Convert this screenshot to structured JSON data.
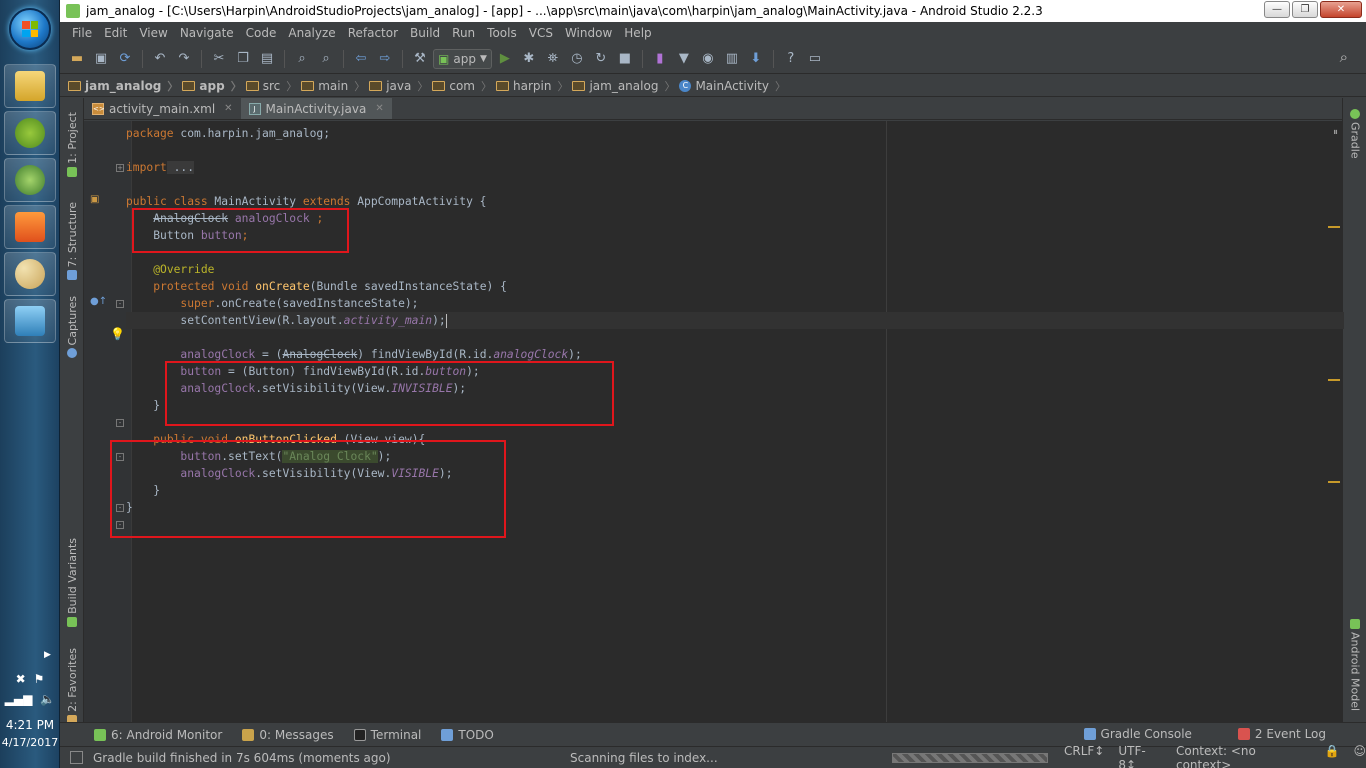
{
  "window": {
    "title": "jam_analog - [C:\\Users\\Harpin\\AndroidStudioProjects\\jam_analog] - [app] - ...\\app\\src\\main\\java\\com\\harpin\\jam_analog\\MainActivity.java - Android Studio 2.2.3",
    "minimize": "—",
    "restore": "❐",
    "close": "✕"
  },
  "menu": [
    "File",
    "Edit",
    "View",
    "Navigate",
    "Code",
    "Analyze",
    "Refactor",
    "Build",
    "Run",
    "Tools",
    "VCS",
    "Window",
    "Help"
  ],
  "toolbar": {
    "run_config": "app"
  },
  "breadcrumbs": [
    "jam_analog",
    "app",
    "src",
    "main",
    "java",
    "com",
    "harpin",
    "jam_analog",
    "MainActivity"
  ],
  "tabs": [
    {
      "label": "activity_main.xml",
      "active": false
    },
    {
      "label": "MainActivity.java",
      "active": true
    }
  ],
  "left_tools": [
    "1: Project",
    "7: Structure",
    "Captures",
    "Build Variants",
    "2: Favorites"
  ],
  "right_tools": [
    "Gradle",
    "Android Model"
  ],
  "code": {
    "l1_kw": "package",
    "l1_rest": " com.harpin.jam_analog;",
    "l3_kw": "import",
    "l3_rest": " ...",
    "l5_kw1": "public class",
    "l5_name": " MainActivity ",
    "l5_kw2": "extends",
    "l5_rest": " AppCompatActivity {",
    "l6_type": "AnalogClock",
    "l6_var": "analogClock",
    "l6_end": " ;",
    "l7_type": "Button ",
    "l7_var": "button",
    "l7_end": ";",
    "l9_ann": "@Override",
    "l10_kw": "protected void",
    "l10_meth": " onCreate",
    "l10_rest": "(Bundle savedInstanceState) {",
    "l11_kw": "super",
    "l11_rest": ".onCreate(savedInstanceState);",
    "l12_a": "setContentView(R.layout.",
    "l12_b": "activity_main",
    "l12_c": ");",
    "l14_a": "analogClock",
    "l14_b": " = (",
    "l14_c": "AnalogClock",
    "l14_d": ") findViewById(R.id.",
    "l14_e": "analogClock",
    "l14_f": ");",
    "l15_a": "button",
    "l15_b": " = (Button) findViewById(R.id.",
    "l15_c": "button",
    "l15_d": ");",
    "l16_a": "analogClock",
    "l16_b": ".setVisibility(View.",
    "l16_c": "INVISIBLE",
    "l16_d": ");",
    "l17": "}",
    "l19_kw": "public void",
    "l19_meth": " onButtonClicked",
    "l19_rest": " (View view){",
    "l20_a": "button",
    "l20_b": ".setText(",
    "l20_str": "\"Analog Clock\"",
    "l20_c": ");",
    "l21_a": "analogClock",
    "l21_b": ".setVisibility(View.",
    "l21_c": "VISIBLE",
    "l21_d": ");",
    "l22": "}",
    "l23": "}"
  },
  "bottom_tools": [
    {
      "label": "6: Android Monitor",
      "icon": "android-monitor-icon",
      "color": "#78c257"
    },
    {
      "label": "0: Messages",
      "icon": "messages-icon",
      "color": "#c9a34b"
    },
    {
      "label": "Terminal",
      "icon": "terminal-icon",
      "color": "#222222"
    },
    {
      "label": "TODO",
      "icon": "todo-icon",
      "color": "#6f9fd8"
    }
  ],
  "bottom_right_tools": [
    "Gradle Console",
    "2 Event Log"
  ],
  "status": {
    "message": "Gradle build finished in 7s 604ms (moments ago)",
    "indexing": "Scanning files to index...",
    "line_sep": "CRLF↕",
    "encoding": "UTF-8↕",
    "context": "Context: <no context>"
  },
  "taskbar": {
    "time": "4:21 PM",
    "date": "4/17/2017"
  },
  "colors": {
    "accent_red": "#e0161c",
    "keyword": "#cc7832",
    "method": "#ffc66d",
    "field": "#9876aa"
  }
}
